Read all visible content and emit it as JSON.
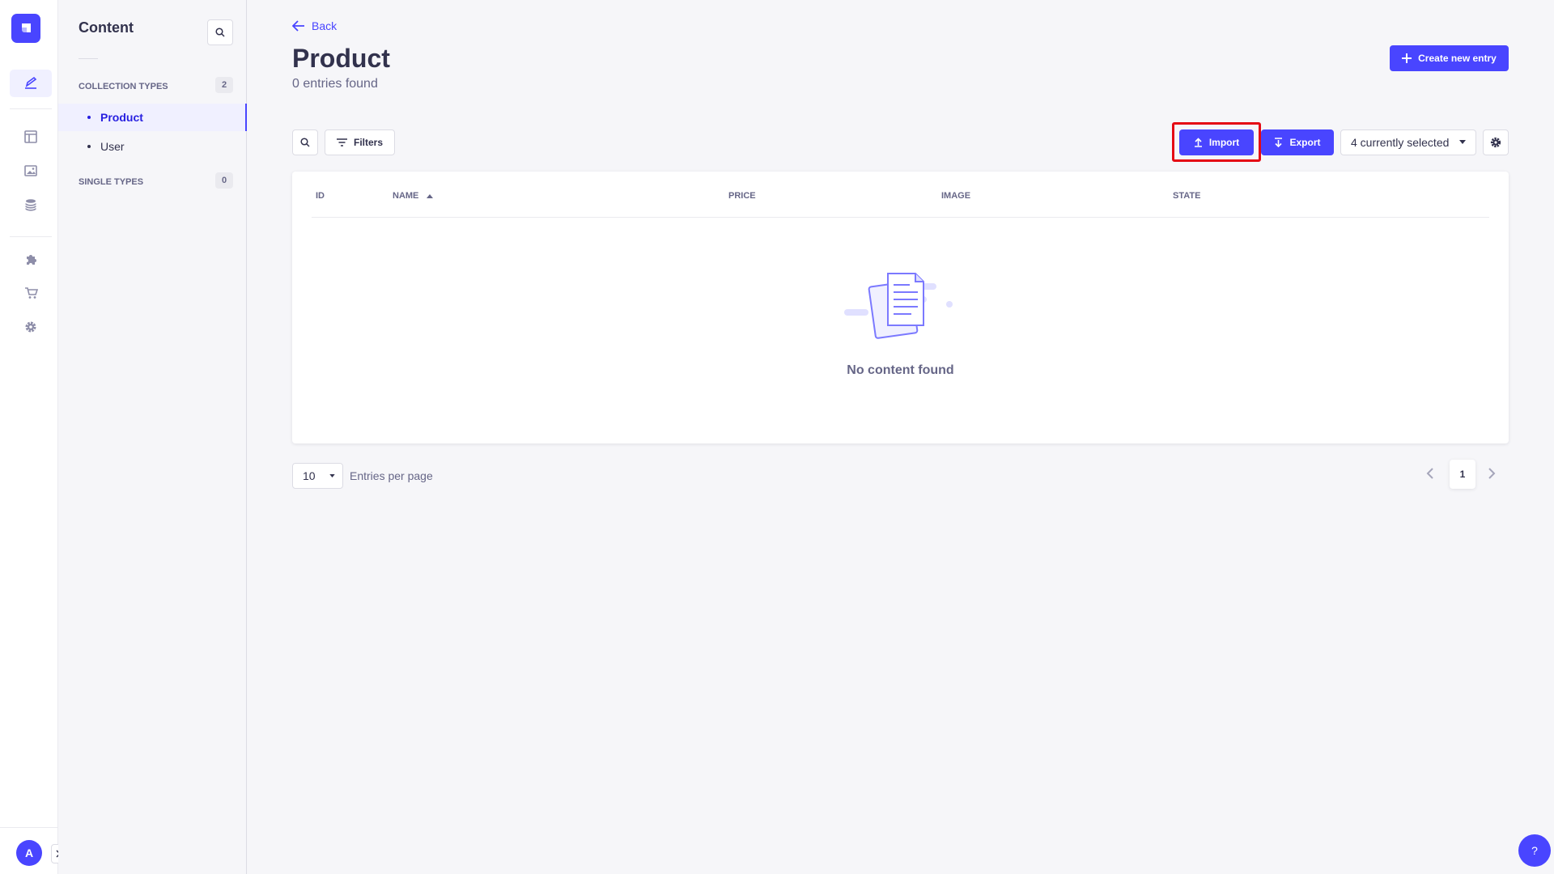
{
  "sidebar": {
    "title": "Content",
    "collection_types_label": "COLLECTION TYPES",
    "collection_types_count": "2",
    "collection_items": [
      {
        "label": "Product"
      },
      {
        "label": "User"
      }
    ],
    "single_types_label": "SINGLE TYPES",
    "single_types_count": "0"
  },
  "rail": {
    "avatar_initial": "A",
    "icons": [
      "content-manager-icon",
      "content-type-builder-icon",
      "media-library-icon",
      "database-icon",
      "plugins-icon",
      "marketplace-icon",
      "settings-icon"
    ]
  },
  "header": {
    "back_label": "Back",
    "title": "Product",
    "subtitle": "0 entries found",
    "create_label": "Create new entry"
  },
  "toolbar": {
    "filters_label": "Filters",
    "import_label": "Import",
    "export_label": "Export",
    "columns_select_value": "4 currently selected"
  },
  "table": {
    "columns": [
      "ID",
      "NAME",
      "PRICE",
      "IMAGE",
      "STATE"
    ],
    "empty_message": "No content found"
  },
  "pagination": {
    "per_page_value": "10",
    "per_page_label": "Entries per page",
    "current_page": "1"
  },
  "help": {
    "label": "?"
  },
  "colors": {
    "primary": "#4945ff",
    "highlight": "#e50914",
    "background": "#f6f6f9"
  }
}
